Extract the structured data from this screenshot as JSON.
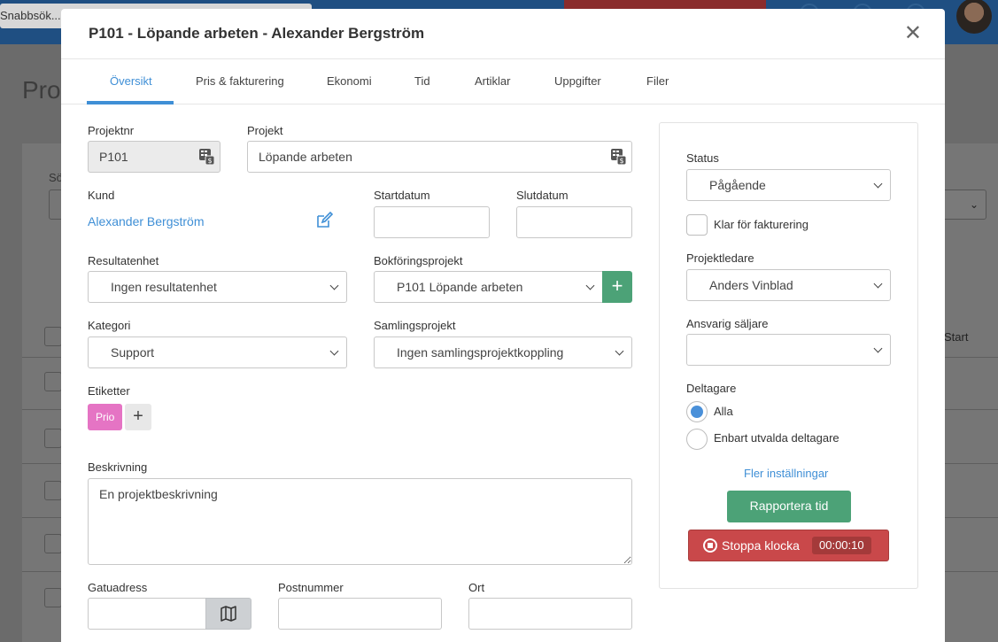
{
  "background": {
    "search_placeholder": "Snabbsök...",
    "page_title": "Pro",
    "filter_label": "Sö",
    "column_start": "Start"
  },
  "modal": {
    "title": "P101 - Löpande arbeten - Alexander Bergström",
    "close_glyph": "✕"
  },
  "tabs": [
    {
      "label": "Översikt",
      "active": true
    },
    {
      "label": "Pris & fakturering"
    },
    {
      "label": "Ekonomi"
    },
    {
      "label": "Tid"
    },
    {
      "label": "Artiklar"
    },
    {
      "label": "Uppgifter"
    },
    {
      "label": "Filer"
    }
  ],
  "form": {
    "projektnr_label": "Projektnr",
    "projektnr_value": "P101",
    "projekt_label": "Projekt",
    "projekt_value": "Löpande arbeten",
    "kund_label": "Kund",
    "kund_value": "Alexander Bergström",
    "startdatum_label": "Startdatum",
    "slutdatum_label": "Slutdatum",
    "resultatenhet_label": "Resultatenhet",
    "resultatenhet_value": "Ingen resultatenhet",
    "bokforingsprojekt_label": "Bokföringsprojekt",
    "bokforingsprojekt_value": "P101 Löpande arbeten",
    "kategori_label": "Kategori",
    "kategori_value": "Support",
    "samlingsprojekt_label": "Samlingsprojekt",
    "samlingsprojekt_value": "Ingen samlingsprojektkoppling",
    "etiketter_label": "Etiketter",
    "tags": [
      "Prio"
    ],
    "beskrivning_label": "Beskrivning",
    "beskrivning_value": "En projektbeskrivning",
    "gatuadress_label": "Gatuadress",
    "postnummer_label": "Postnummer",
    "ort_label": "Ort"
  },
  "panel": {
    "status_label": "Status",
    "status_value": "Pågående",
    "klar_label": "Klar för fakturering",
    "projektledare_label": "Projektledare",
    "projektledare_value": "Anders Vinblad",
    "saljare_label": "Ansvarig säljare",
    "saljare_value": "",
    "deltagare_label": "Deltagare",
    "deltagare_options": [
      "Alla",
      "Enbart utvalda deltagare"
    ],
    "deltagare_selected": "Alla",
    "fler_link": "Fler inställningar",
    "rapportera_label": "Rapportera tid",
    "stoppa_label": "Stoppa klocka",
    "timer_value": "00:00:10"
  },
  "colors": {
    "accent": "#3f8fd6",
    "green": "#4ca277",
    "red": "#c9484a",
    "tag": "#e574c4"
  }
}
